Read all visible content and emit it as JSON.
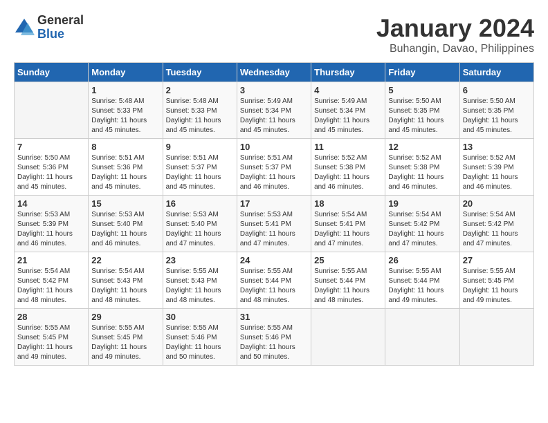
{
  "logo": {
    "general": "General",
    "blue": "Blue"
  },
  "title": "January 2024",
  "subtitle": "Buhangin, Davao, Philippines",
  "weekdays": [
    "Sunday",
    "Monday",
    "Tuesday",
    "Wednesday",
    "Thursday",
    "Friday",
    "Saturday"
  ],
  "weeks": [
    [
      {
        "day": "",
        "info": ""
      },
      {
        "day": "1",
        "info": "Sunrise: 5:48 AM\nSunset: 5:33 PM\nDaylight: 11 hours\nand 45 minutes."
      },
      {
        "day": "2",
        "info": "Sunrise: 5:48 AM\nSunset: 5:33 PM\nDaylight: 11 hours\nand 45 minutes."
      },
      {
        "day": "3",
        "info": "Sunrise: 5:49 AM\nSunset: 5:34 PM\nDaylight: 11 hours\nand 45 minutes."
      },
      {
        "day": "4",
        "info": "Sunrise: 5:49 AM\nSunset: 5:34 PM\nDaylight: 11 hours\nand 45 minutes."
      },
      {
        "day": "5",
        "info": "Sunrise: 5:50 AM\nSunset: 5:35 PM\nDaylight: 11 hours\nand 45 minutes."
      },
      {
        "day": "6",
        "info": "Sunrise: 5:50 AM\nSunset: 5:35 PM\nDaylight: 11 hours\nand 45 minutes."
      }
    ],
    [
      {
        "day": "7",
        "info": "Sunrise: 5:50 AM\nSunset: 5:36 PM\nDaylight: 11 hours\nand 45 minutes."
      },
      {
        "day": "8",
        "info": "Sunrise: 5:51 AM\nSunset: 5:36 PM\nDaylight: 11 hours\nand 45 minutes."
      },
      {
        "day": "9",
        "info": "Sunrise: 5:51 AM\nSunset: 5:37 PM\nDaylight: 11 hours\nand 45 minutes."
      },
      {
        "day": "10",
        "info": "Sunrise: 5:51 AM\nSunset: 5:37 PM\nDaylight: 11 hours\nand 46 minutes."
      },
      {
        "day": "11",
        "info": "Sunrise: 5:52 AM\nSunset: 5:38 PM\nDaylight: 11 hours\nand 46 minutes."
      },
      {
        "day": "12",
        "info": "Sunrise: 5:52 AM\nSunset: 5:38 PM\nDaylight: 11 hours\nand 46 minutes."
      },
      {
        "day": "13",
        "info": "Sunrise: 5:52 AM\nSunset: 5:39 PM\nDaylight: 11 hours\nand 46 minutes."
      }
    ],
    [
      {
        "day": "14",
        "info": "Sunrise: 5:53 AM\nSunset: 5:39 PM\nDaylight: 11 hours\nand 46 minutes."
      },
      {
        "day": "15",
        "info": "Sunrise: 5:53 AM\nSunset: 5:40 PM\nDaylight: 11 hours\nand 46 minutes."
      },
      {
        "day": "16",
        "info": "Sunrise: 5:53 AM\nSunset: 5:40 PM\nDaylight: 11 hours\nand 47 minutes."
      },
      {
        "day": "17",
        "info": "Sunrise: 5:53 AM\nSunset: 5:41 PM\nDaylight: 11 hours\nand 47 minutes."
      },
      {
        "day": "18",
        "info": "Sunrise: 5:54 AM\nSunset: 5:41 PM\nDaylight: 11 hours\nand 47 minutes."
      },
      {
        "day": "19",
        "info": "Sunrise: 5:54 AM\nSunset: 5:42 PM\nDaylight: 11 hours\nand 47 minutes."
      },
      {
        "day": "20",
        "info": "Sunrise: 5:54 AM\nSunset: 5:42 PM\nDaylight: 11 hours\nand 47 minutes."
      }
    ],
    [
      {
        "day": "21",
        "info": "Sunrise: 5:54 AM\nSunset: 5:42 PM\nDaylight: 11 hours\nand 48 minutes."
      },
      {
        "day": "22",
        "info": "Sunrise: 5:54 AM\nSunset: 5:43 PM\nDaylight: 11 hours\nand 48 minutes."
      },
      {
        "day": "23",
        "info": "Sunrise: 5:55 AM\nSunset: 5:43 PM\nDaylight: 11 hours\nand 48 minutes."
      },
      {
        "day": "24",
        "info": "Sunrise: 5:55 AM\nSunset: 5:44 PM\nDaylight: 11 hours\nand 48 minutes."
      },
      {
        "day": "25",
        "info": "Sunrise: 5:55 AM\nSunset: 5:44 PM\nDaylight: 11 hours\nand 48 minutes."
      },
      {
        "day": "26",
        "info": "Sunrise: 5:55 AM\nSunset: 5:44 PM\nDaylight: 11 hours\nand 49 minutes."
      },
      {
        "day": "27",
        "info": "Sunrise: 5:55 AM\nSunset: 5:45 PM\nDaylight: 11 hours\nand 49 minutes."
      }
    ],
    [
      {
        "day": "28",
        "info": "Sunrise: 5:55 AM\nSunset: 5:45 PM\nDaylight: 11 hours\nand 49 minutes."
      },
      {
        "day": "29",
        "info": "Sunrise: 5:55 AM\nSunset: 5:45 PM\nDaylight: 11 hours\nand 49 minutes."
      },
      {
        "day": "30",
        "info": "Sunrise: 5:55 AM\nSunset: 5:46 PM\nDaylight: 11 hours\nand 50 minutes."
      },
      {
        "day": "31",
        "info": "Sunrise: 5:55 AM\nSunset: 5:46 PM\nDaylight: 11 hours\nand 50 minutes."
      },
      {
        "day": "",
        "info": ""
      },
      {
        "day": "",
        "info": ""
      },
      {
        "day": "",
        "info": ""
      }
    ]
  ]
}
